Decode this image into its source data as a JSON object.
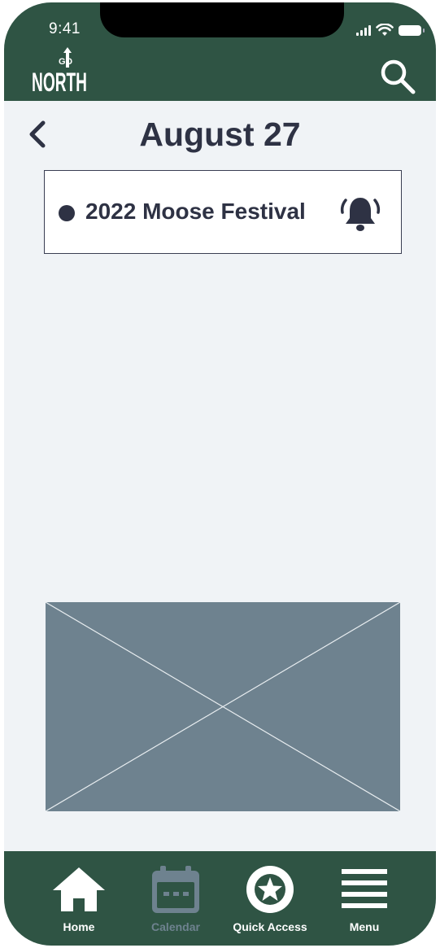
{
  "status_bar": {
    "time": "9:41"
  },
  "header": {
    "logo_text_top": "GO",
    "logo_text_main": "NORTH",
    "search_icon": "search-icon"
  },
  "page": {
    "title": "August 27",
    "back_icon": "chevron-left-icon"
  },
  "events": [
    {
      "name": "2022 Moose Festival",
      "icon": "bell-ringing-icon"
    }
  ],
  "tabbar": {
    "items": [
      {
        "label": "Home",
        "icon": "home-icon",
        "active": true
      },
      {
        "label": "Calendar",
        "icon": "calendar-icon",
        "active": false
      },
      {
        "label": "Quick Access",
        "icon": "star-icon",
        "active": true
      },
      {
        "label": "Menu",
        "icon": "menu-icon",
        "active": true
      }
    ]
  },
  "colors": {
    "brand_green": "#2f5444",
    "background": "#f0f3f6",
    "text_dark": "#2e3244",
    "placeholder_gray": "#6e828f"
  }
}
